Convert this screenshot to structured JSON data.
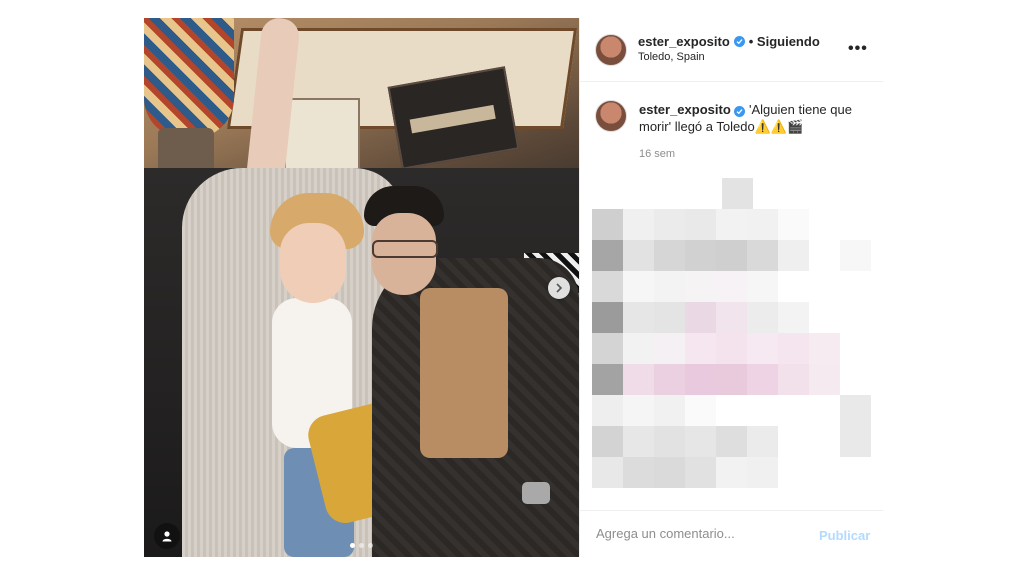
{
  "post": {
    "username": "ester_exposito",
    "follow_status": "• Siguiendo",
    "location": "Toledo, Spain",
    "caption_username": "ester_exposito",
    "caption_text": "'Alguien tiene que morir' llegó a Toledo⚠️⚠️🎬",
    "time_ago": "16 sem",
    "more_icon": "more-horizontal-icon",
    "comment_placeholder": "Agrega un comentario...",
    "publish_label": "Publicar"
  },
  "colors": {
    "verified": "#3897f0",
    "publish_disabled": "#b3dbff",
    "border": "#efefef",
    "muted_text": "#8e8e8e"
  }
}
